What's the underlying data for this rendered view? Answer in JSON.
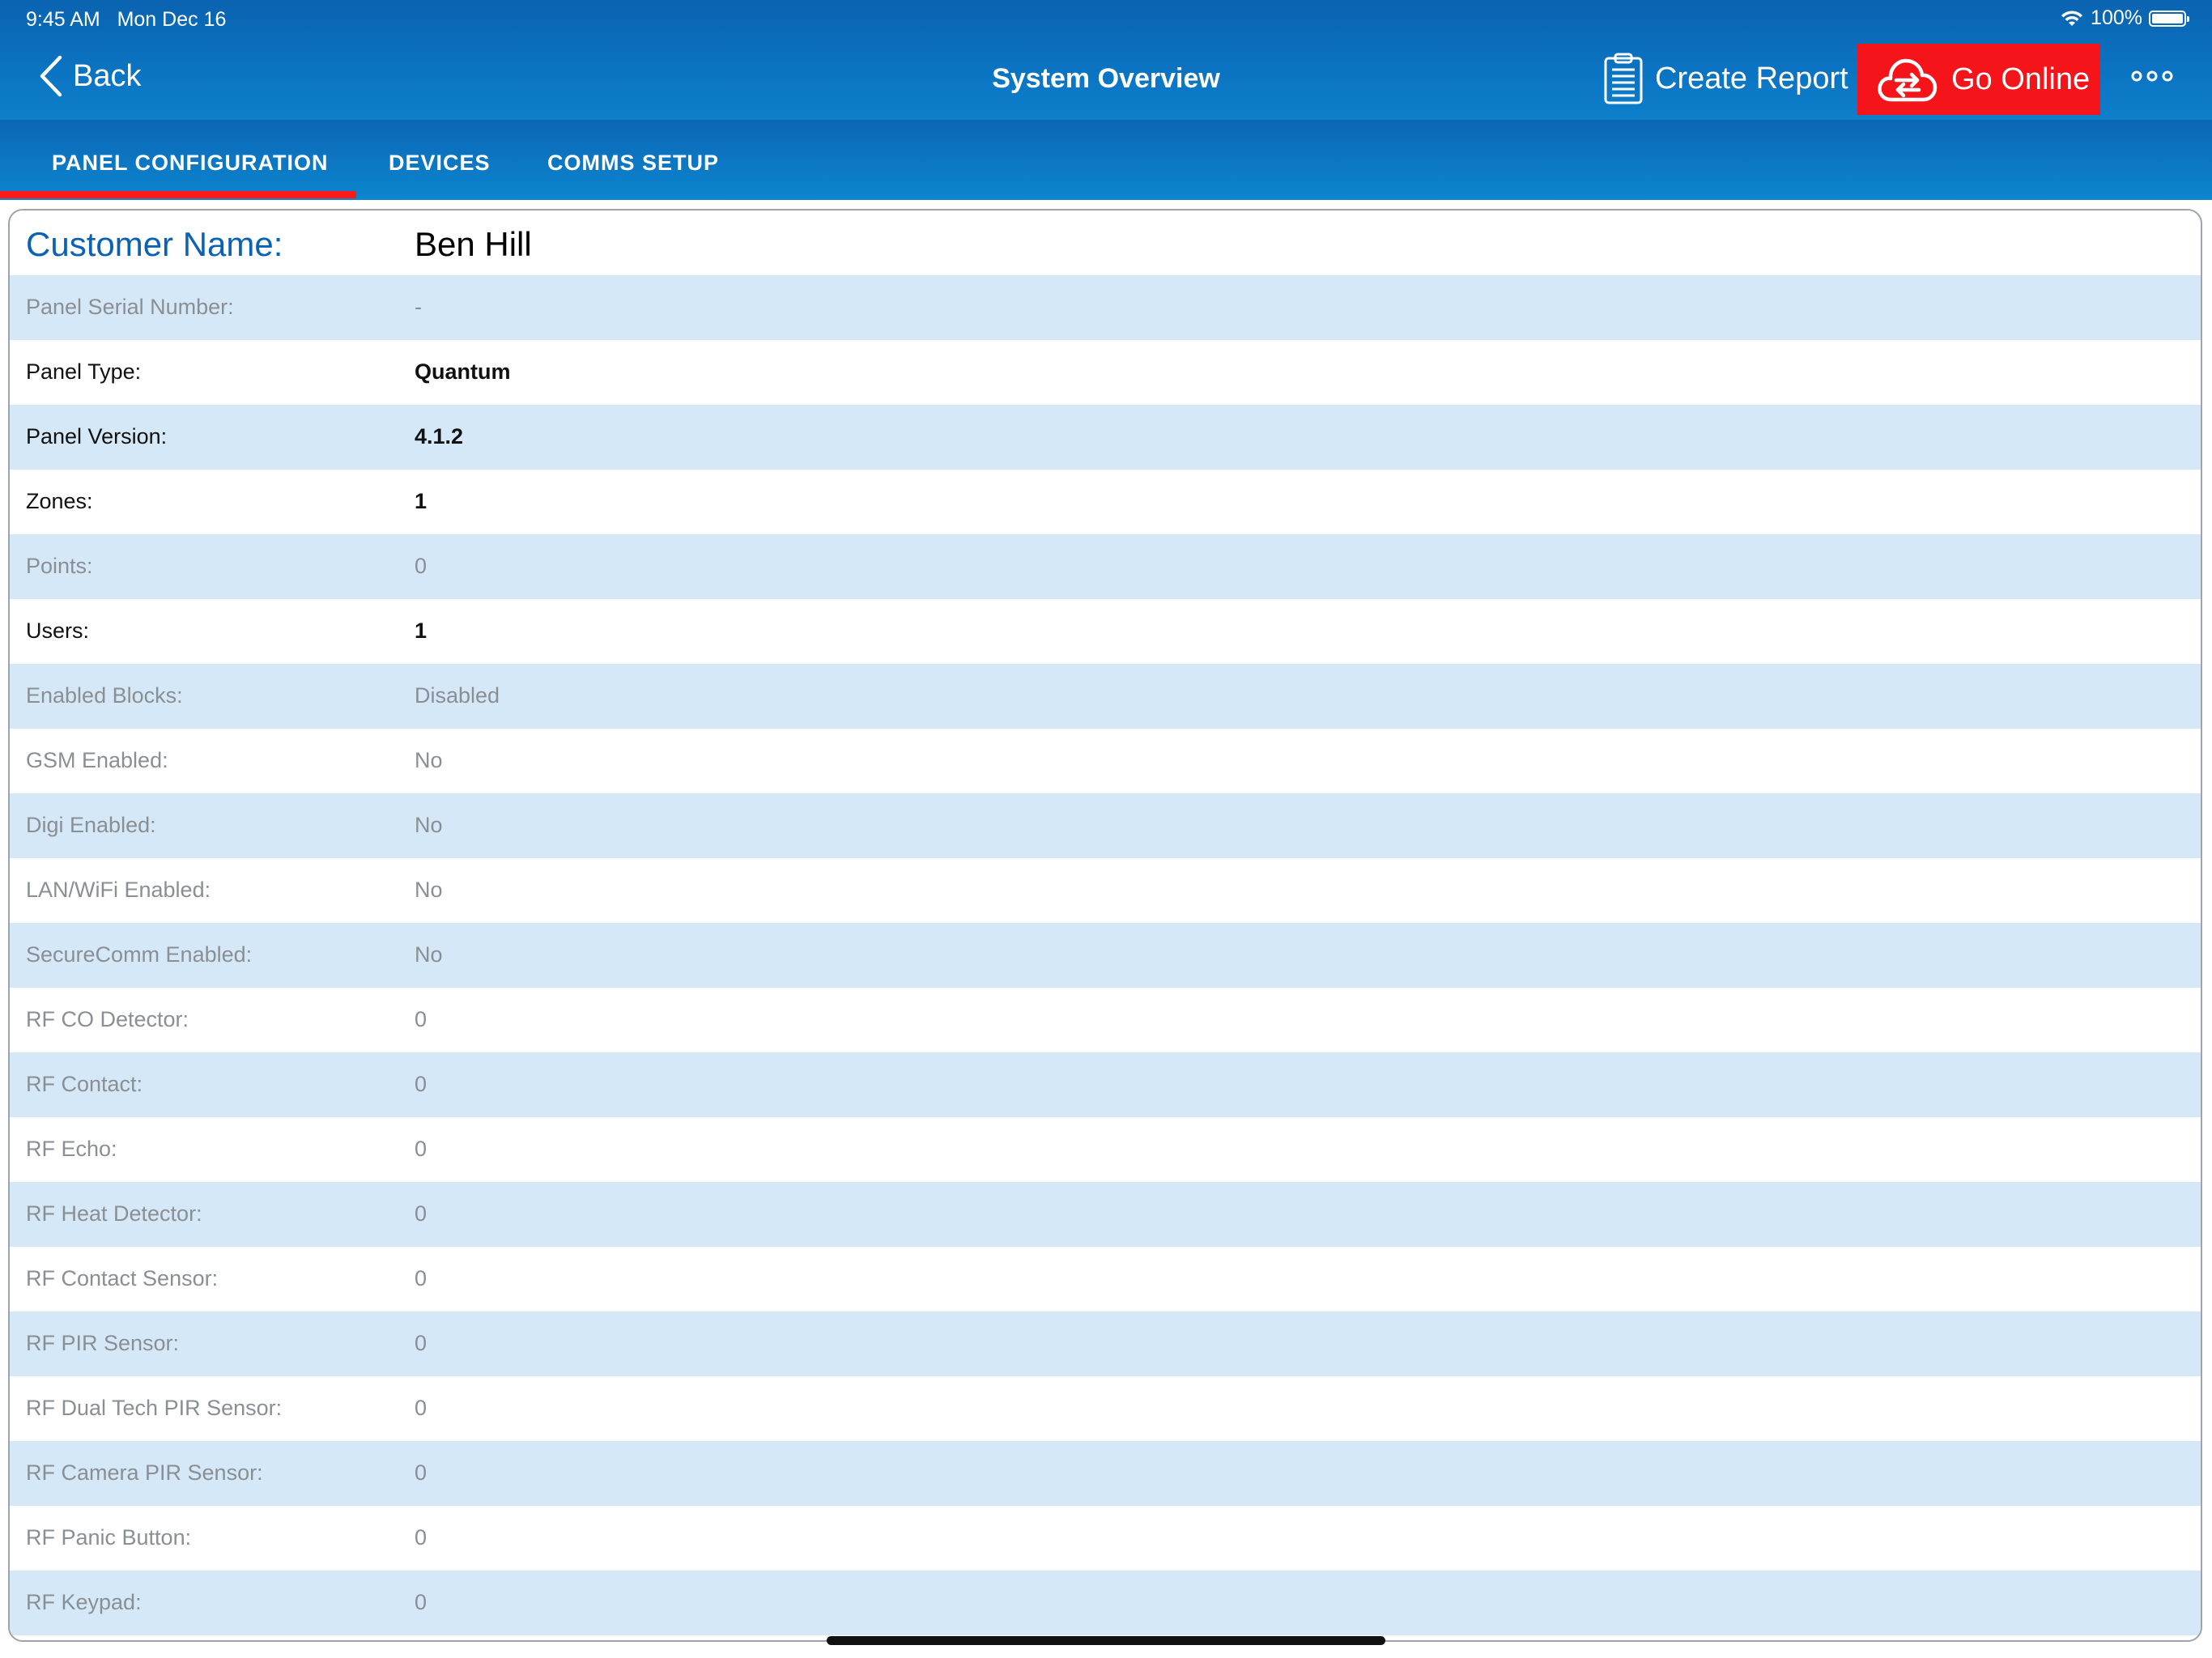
{
  "status_bar": {
    "time": "9:45 AM",
    "date": "Mon Dec 16",
    "battery": "100%"
  },
  "nav": {
    "back_label": "Back",
    "title": "System Overview",
    "create_report_label": "Create Report",
    "go_online_label": "Go Online",
    "more_icon": "ellipsis-icon"
  },
  "tabs": [
    {
      "label": "PANEL CONFIGURATION",
      "selected": true
    },
    {
      "label": "DEVICES",
      "selected": false
    },
    {
      "label": "COMMS SETUP",
      "selected": false
    }
  ],
  "customer": {
    "label": "Customer Name:",
    "value": "Ben Hill"
  },
  "rows": [
    {
      "label": "Panel Serial Number:",
      "value": "-"
    },
    {
      "label": "Panel Type:",
      "value": "Quantum"
    },
    {
      "label": "Panel Version:",
      "value": "4.1.2"
    },
    {
      "label": "Zones:",
      "value": "1"
    },
    {
      "label": "Points:",
      "value": "0"
    },
    {
      "label": "Users:",
      "value": "1"
    },
    {
      "label": "Enabled Blocks:",
      "value": "Disabled"
    },
    {
      "label": "GSM Enabled:",
      "value": "No"
    },
    {
      "label": "Digi Enabled:",
      "value": "No"
    },
    {
      "label": "LAN/WiFi Enabled:",
      "value": "No"
    },
    {
      "label": "SecureComm Enabled:",
      "value": "No"
    },
    {
      "label": "RF CO Detector:",
      "value": "0"
    },
    {
      "label": "RF Contact:",
      "value": "0"
    },
    {
      "label": "RF Echo:",
      "value": "0"
    },
    {
      "label": "RF Heat Detector:",
      "value": "0"
    },
    {
      "label": "RF Contact Sensor:",
      "value": "0"
    },
    {
      "label": "RF PIR Sensor:",
      "value": "0"
    },
    {
      "label": "RF Dual Tech PIR Sensor:",
      "value": "0"
    },
    {
      "label": "RF Camera PIR Sensor:",
      "value": "0"
    },
    {
      "label": "RF Panic Button:",
      "value": "0"
    },
    {
      "label": "RF Keypad:",
      "value": "0"
    }
  ],
  "colors": {
    "header_blue": "#0b74c2",
    "go_online_red": "#f4141a",
    "tab_underline": "#ff1a1a",
    "row_shade": "#d5e8f7",
    "customer_label": "#0b62b5"
  }
}
